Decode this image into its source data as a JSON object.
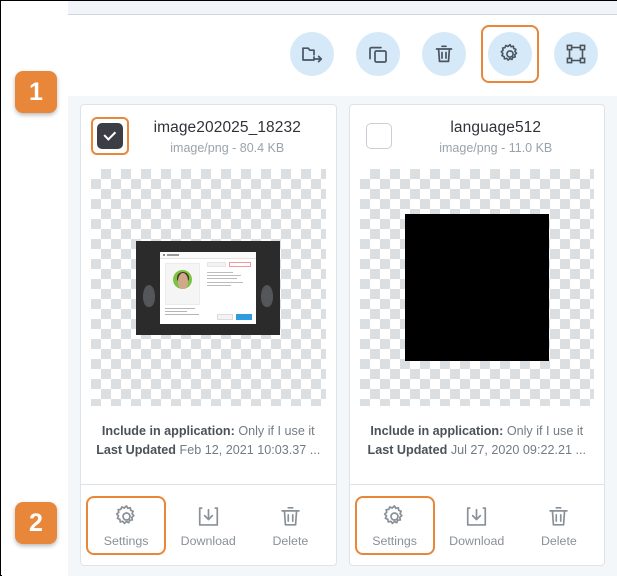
{
  "toolbar": {
    "buttons": [
      {
        "name": "move-to-folder-icon",
        "label": "Move to folder"
      },
      {
        "name": "duplicate-icon",
        "label": "Duplicate"
      },
      {
        "name": "trash-icon",
        "label": "Delete"
      },
      {
        "name": "gear-icon",
        "label": "Settings",
        "highlighted": true
      },
      {
        "name": "resize-icon",
        "label": "Resize"
      }
    ]
  },
  "badges": [
    {
      "text": "1"
    },
    {
      "text": "2"
    }
  ],
  "cards": [
    {
      "title": "image202025_18232",
      "subtitle": "image/png - 80.4 KB",
      "checked": true,
      "checkbox_highlighted": true,
      "meta": {
        "include_key": "Include in application:",
        "include_value": "Only if I use it",
        "updated_key": "Last Updated",
        "updated_value": "Feb 12, 2021 10:03.37 ..."
      },
      "actions": [
        {
          "label": "Settings",
          "icon": "gear-icon",
          "highlighted": true
        },
        {
          "label": "Download",
          "icon": "download-icon",
          "highlighted": false
        },
        {
          "label": "Delete",
          "icon": "trash-icon",
          "highlighted": false
        }
      ]
    },
    {
      "title": "language512",
      "subtitle": "image/png - 11.0 KB",
      "checked": false,
      "checkbox_highlighted": false,
      "meta": {
        "include_key": "Include in application:",
        "include_value": "Only if I use it",
        "updated_key": "Last Updated",
        "updated_value": "Jul 27, 2020 09:22.21 ..."
      },
      "actions": [
        {
          "label": "Settings",
          "icon": "gear-icon",
          "highlighted": true
        },
        {
          "label": "Download",
          "icon": "download-icon",
          "highlighted": false
        },
        {
          "label": "Delete",
          "icon": "trash-icon",
          "highlighted": false
        }
      ]
    }
  ],
  "colors": {
    "accent_orange": "#e8873a",
    "tool_circle": "#d6e9f8",
    "panel_bg": "#f4f7fa",
    "icon_stroke": "#4a5560"
  }
}
